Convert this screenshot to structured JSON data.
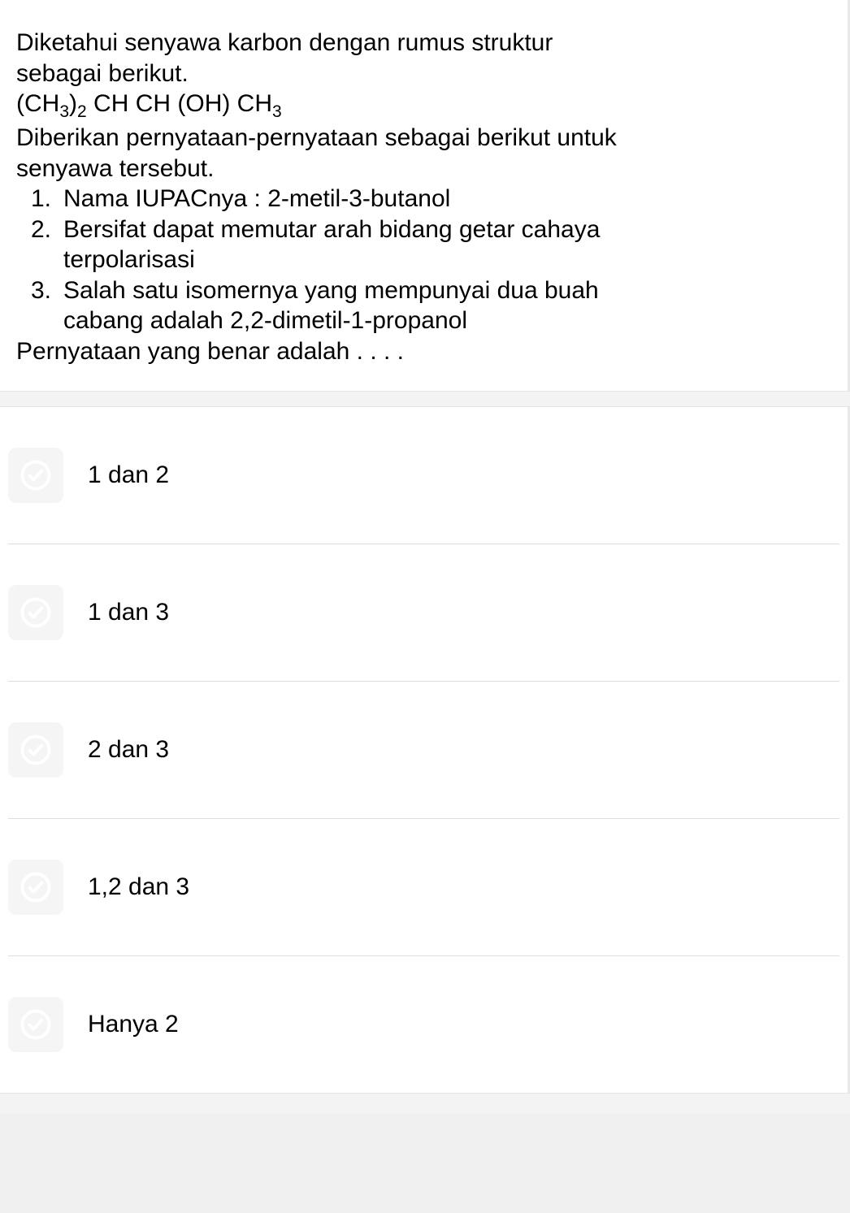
{
  "question": {
    "intro1": "Diketahui senyawa karbon dengan rumus struktur sebagai berikut.",
    "formula_parts": {
      "p1": "(CH",
      "s1": "3",
      "p2": ")",
      "s2": "2",
      "p3": " CH CH (OH) CH",
      "s3": "3"
    },
    "intro2": "Diberikan pernyataan-pernyataan sebagai berikut untuk senyawa tersebut.",
    "statements": [
      {
        "num": "1.",
        "text": "Nama IUPACnya : 2-metil-3-butanol"
      },
      {
        "num": "2.",
        "text": "Bersifat dapat memutar arah bidang getar cahaya terpolarisasi"
      },
      {
        "num": "3.",
        "text": "Salah satu isomernya yang mempunyai dua buah cabang adalah 2,2-dimetil-1-propanol"
      }
    ],
    "closing": "Pernyataan yang benar adalah . . . ."
  },
  "options": [
    {
      "label": "1 dan 2"
    },
    {
      "label": "1 dan 3"
    },
    {
      "label": "2 dan 3"
    },
    {
      "label": "1,2 dan 3"
    },
    {
      "label": "Hanya 2"
    }
  ]
}
